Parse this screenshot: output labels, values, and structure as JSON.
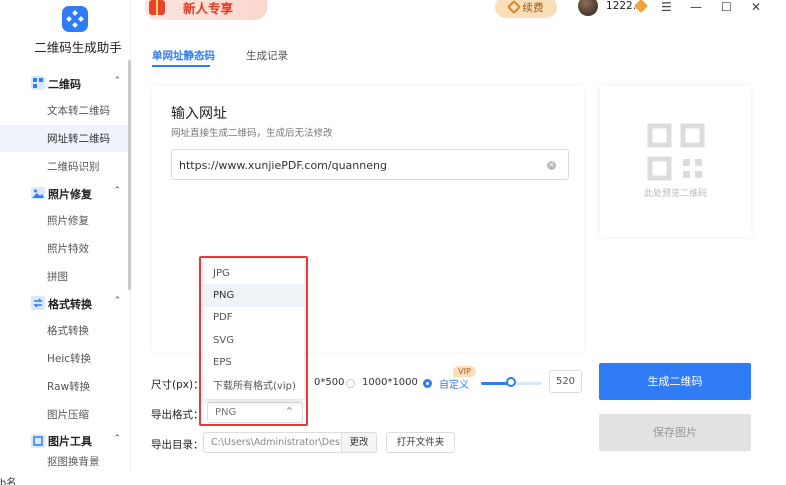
{
  "app": {
    "title": "二维码生成助手"
  },
  "colors": {
    "accent": "#2f7cf6",
    "promo_red": "#e13a1f",
    "highlight_red": "#e43a3a"
  },
  "sidebar": {
    "groups": [
      {
        "label": "二维码",
        "icon": "qr-icon",
        "items": [
          "文本转二维码",
          "网址转二维码",
          "二维码识别"
        ],
        "active": "网址转二维码"
      },
      {
        "label": "照片修复",
        "icon": "photo-icon",
        "items": [
          "照片修复",
          "照片特效",
          "拼图"
        ]
      },
      {
        "label": "格式转换",
        "icon": "convert-icon",
        "items": [
          "格式转换",
          "Heic转换",
          "Raw转换",
          "图片压缩"
        ]
      },
      {
        "label": "图片工具",
        "icon": "image-tool-icon",
        "items": [
          "抠图换背景"
        ]
      }
    ]
  },
  "topbar": {
    "promo": "新人专享",
    "renew": "续费",
    "user": "1222...",
    "window_controls": [
      "☰",
      "—",
      "☐",
      "✕"
    ]
  },
  "tabs": {
    "active": "单网址静态码",
    "record": "生成记录"
  },
  "panel": {
    "title": "输入网址",
    "subtitle": "网址直接生成二维码，生成后无法修改",
    "url_value": "https://www.xunjiePDF.com/quanneng"
  },
  "preview": {
    "placeholder": "此处预览二维码"
  },
  "options": {
    "size_label": "尺寸(px)：",
    "size_opt1": "0*500",
    "size_opt2": "1000*1000",
    "size_custom": "自定义",
    "vip": "VIP",
    "size_value": "520",
    "slider_fraction": 0.51,
    "format_label": "导出格式：",
    "format_value": "PNG",
    "dir_label": "导出目录：",
    "dir_value": "C:\\Users\\Administrator\\Des",
    "change": "更改",
    "open_folder": "打开文件夹"
  },
  "dropdown": {
    "items": [
      "JPG",
      "PNG",
      "PDF",
      "SVG",
      "EPS",
      "下载所有格式(vip)"
    ],
    "selected": "PNG"
  },
  "actions": {
    "generate": "生成二维码",
    "save": "保存图片"
  },
  "bottom": {
    "text": "h名"
  }
}
